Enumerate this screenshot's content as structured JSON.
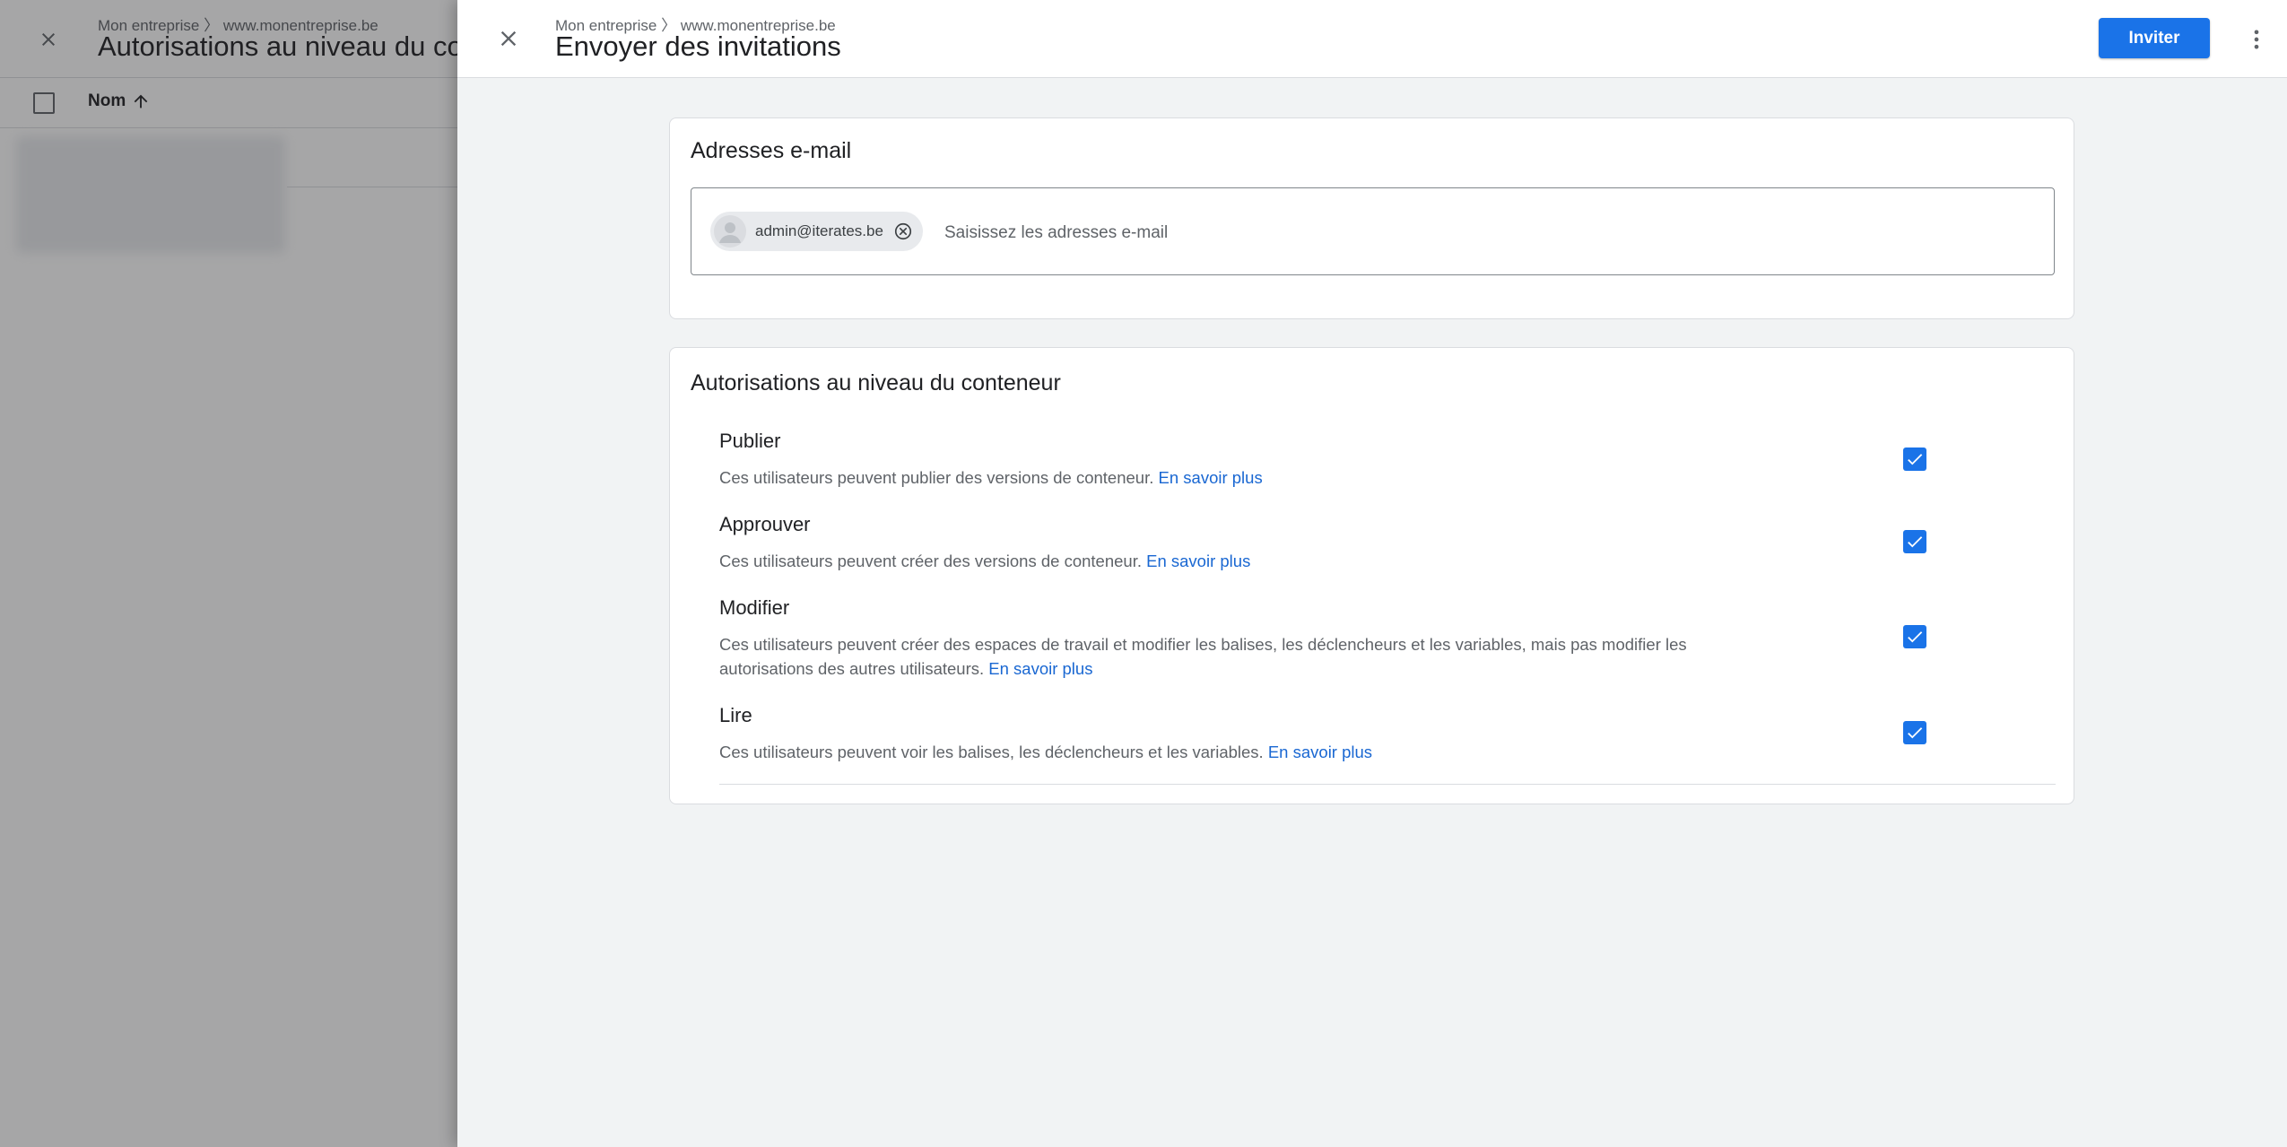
{
  "background_page": {
    "breadcrumb": "Mon entreprise 〉 www.monentreprise.be",
    "title": "Autorisations au niveau du conteneur",
    "table": {
      "name_column": "Nom"
    }
  },
  "panel": {
    "breadcrumb": "Mon entreprise 〉 www.monentreprise.be",
    "title": "Envoyer des invitations",
    "invite_button": "Inviter",
    "email_section": {
      "title": "Adresses e-mail",
      "chips": [
        "admin@iterates.be"
      ],
      "input_placeholder": "Saisissez les adresses e-mail"
    },
    "permissions_section": {
      "title": "Autorisations au niveau du conteneur",
      "items": [
        {
          "name": "Publier",
          "description": "Ces utilisateurs peuvent publier des versions de conteneur.",
          "link": "En savoir plus",
          "checked": true
        },
        {
          "name": "Approuver",
          "description": "Ces utilisateurs peuvent créer des versions de conteneur.",
          "link": "En savoir plus",
          "checked": true
        },
        {
          "name": "Modifier",
          "description": "Ces utilisateurs peuvent créer des espaces de travail et modifier les balises, les déclencheurs et les variables, mais pas modifier les autorisations des autres utilisateurs.",
          "link": "En savoir plus",
          "checked": true
        },
        {
          "name": "Lire",
          "description": "Ces utilisateurs peuvent voir les balises, les déclencheurs et les variables.",
          "link": "En savoir plus",
          "checked": true
        }
      ]
    }
  },
  "icons": {
    "close": "close-icon",
    "more": "more-vert-icon",
    "sort": "arrow-upward-icon",
    "avatar": "person-icon",
    "chip_remove": "cancel-circle-icon",
    "checkbox": "check-icon"
  },
  "colors": {
    "primary": "#1a73e8",
    "link": "#1967d2",
    "panel_background": "#f1f3f4"
  }
}
